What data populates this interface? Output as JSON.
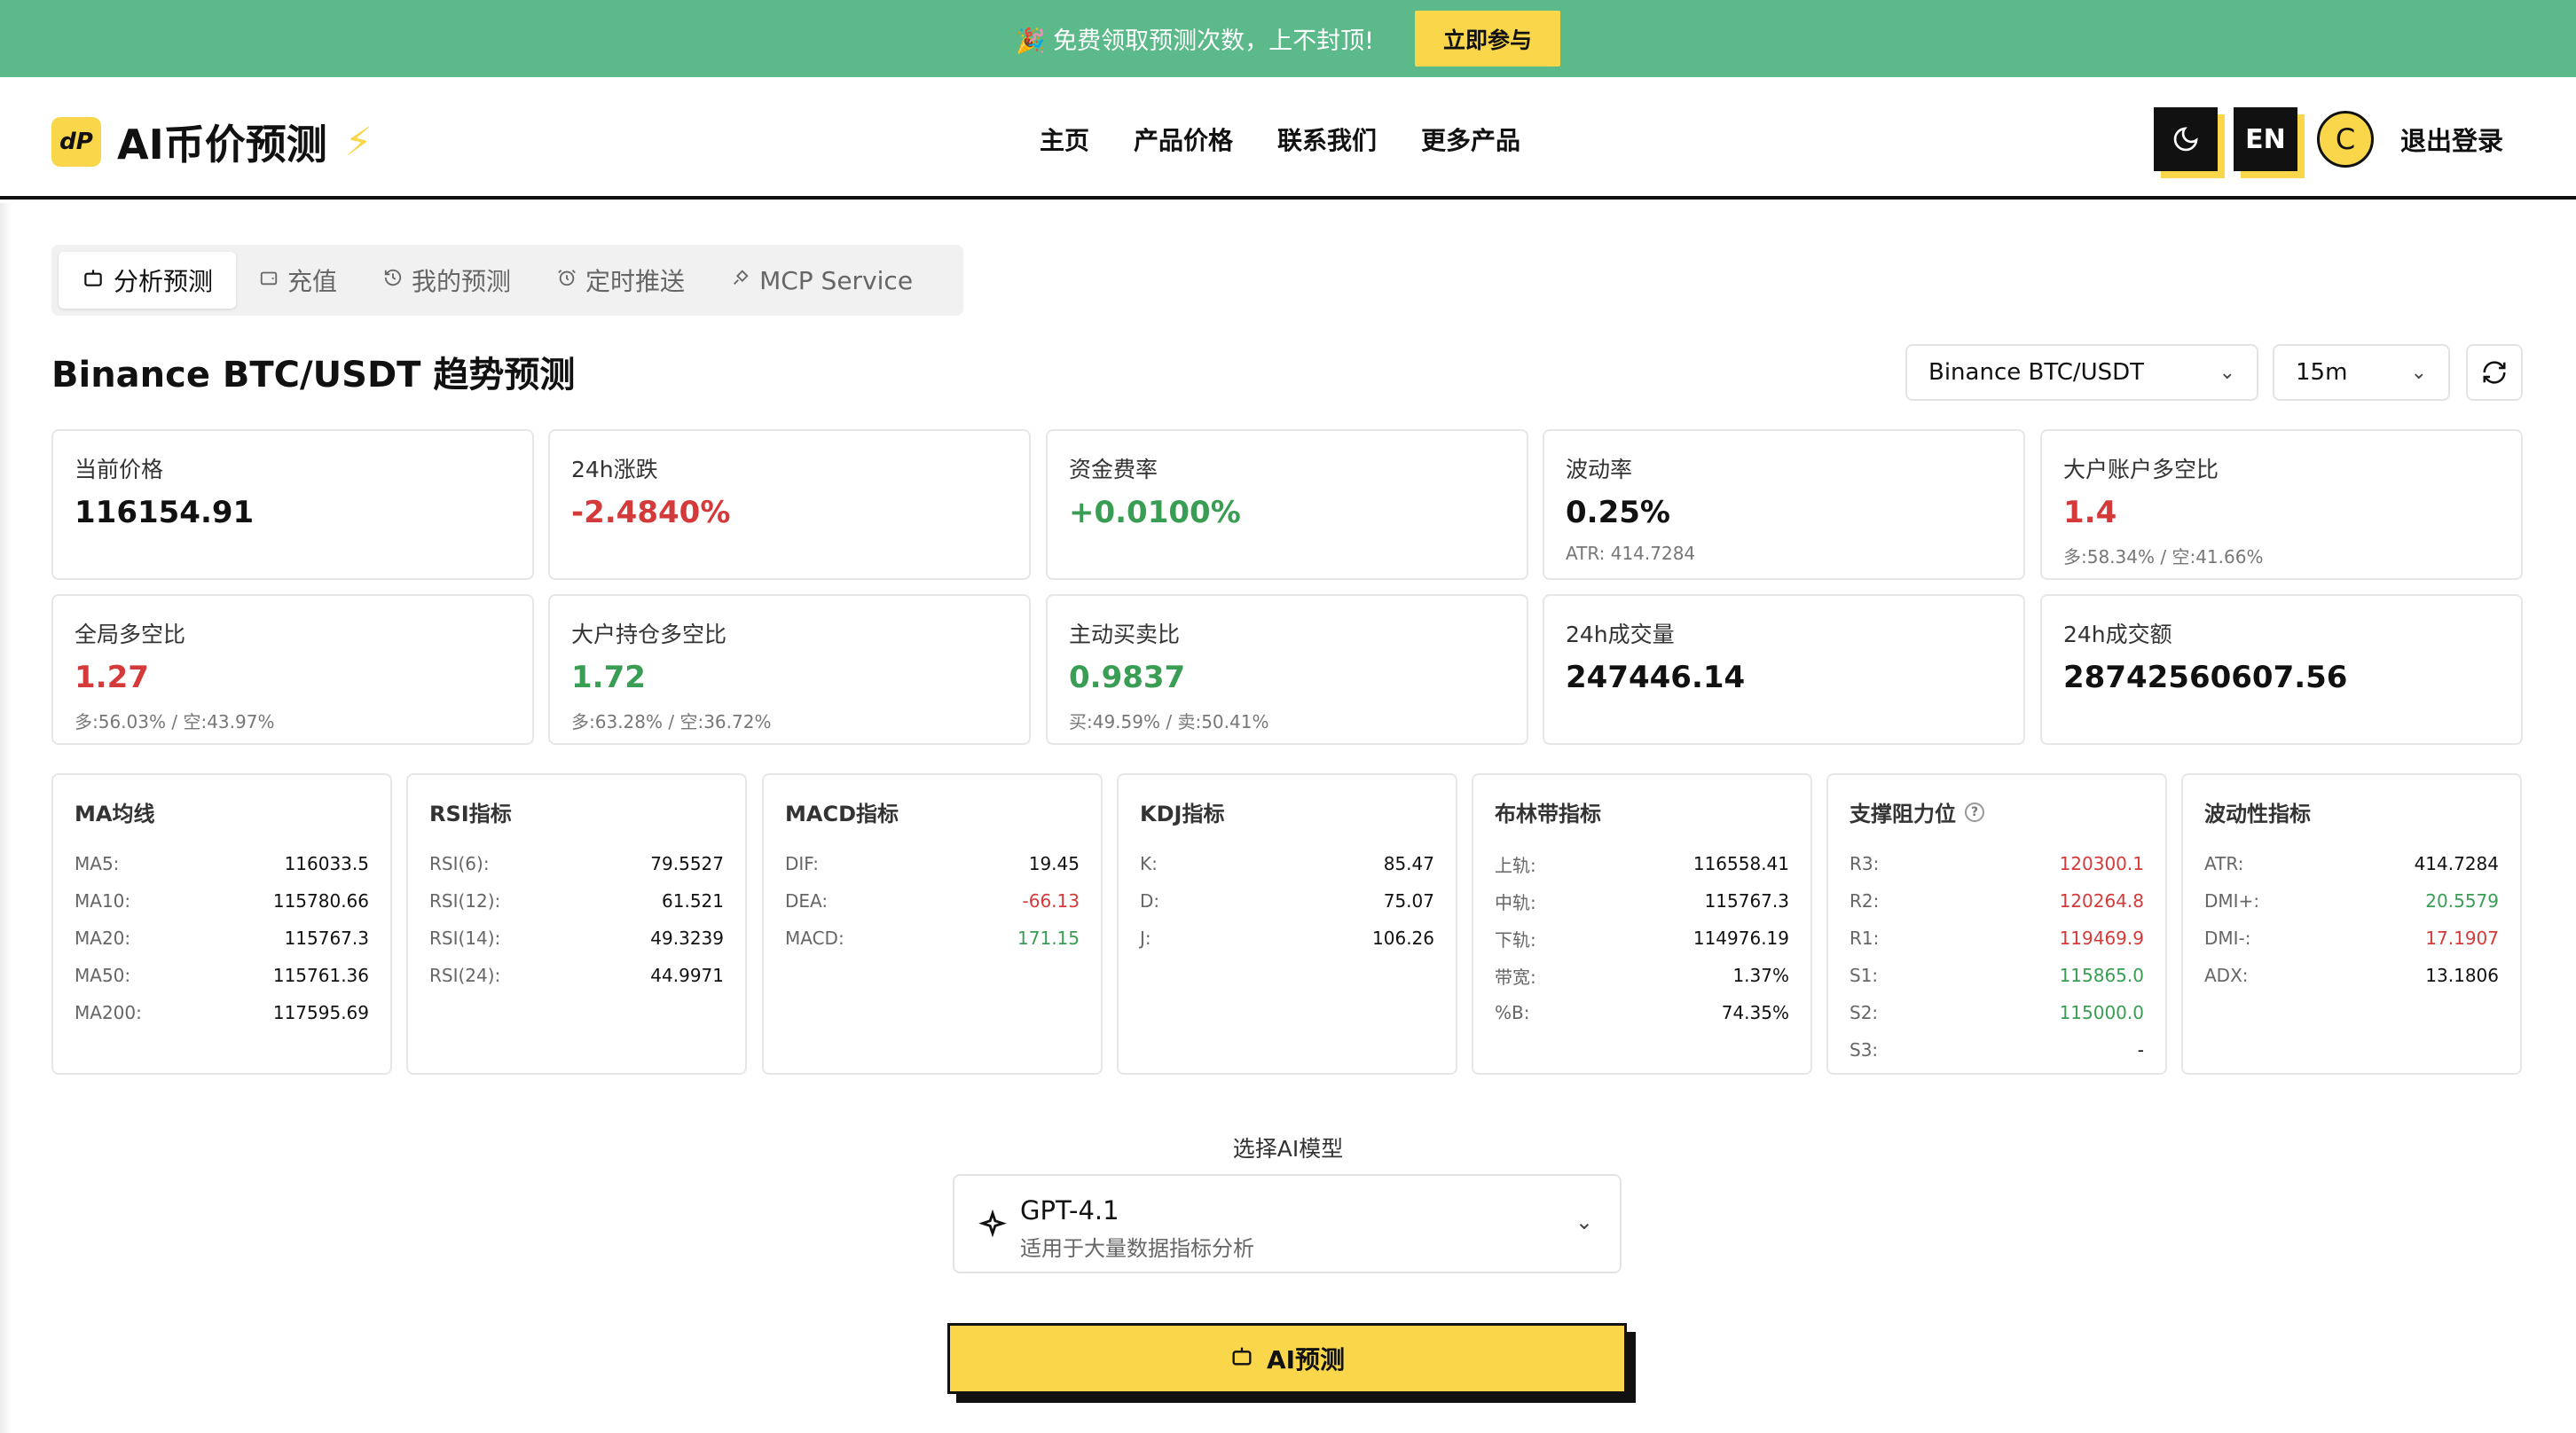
{
  "banner": {
    "text": "🎉 免费领取预测次数，上不封顶!",
    "button": "立即参与"
  },
  "header": {
    "logo_mark": "dP",
    "title": "AI币价预测",
    "nav": [
      "主页",
      "产品价格",
      "联系我们",
      "更多产品"
    ],
    "lang": "EN",
    "avatar": "C",
    "logout": "退出登录"
  },
  "tabs": [
    {
      "label": "分析预测",
      "icon": "robot-icon",
      "active": true
    },
    {
      "label": "充值",
      "icon": "wallet-icon",
      "active": false
    },
    {
      "label": "我的预测",
      "icon": "history-icon",
      "active": false
    },
    {
      "label": "定时推送",
      "icon": "alarm-icon",
      "active": false
    },
    {
      "label": "MCP Service",
      "icon": "plug-icon",
      "active": false
    }
  ],
  "page_title": "Binance BTC/USDT 趋势预测",
  "selectors": {
    "pair": "Binance BTC/USDT",
    "interval": "15m"
  },
  "stats": [
    {
      "label": "当前价格",
      "value": "116154.91",
      "sub": "",
      "tone": "neutral"
    },
    {
      "label": "24h涨跌",
      "value": "-2.4840%",
      "sub": "",
      "tone": "red"
    },
    {
      "label": "资金费率",
      "value": "+0.0100%",
      "sub": "",
      "tone": "green"
    },
    {
      "label": "波动率",
      "value": "0.25%",
      "sub": "ATR: 414.7284",
      "tone": "neutral"
    },
    {
      "label": "大户账户多空比",
      "value": "1.4",
      "sub": "多:58.34% / 空:41.66%",
      "tone": "red"
    },
    {
      "label": "全局多空比",
      "value": "1.27",
      "sub": "多:56.03% / 空:43.97%",
      "tone": "red"
    },
    {
      "label": "大户持仓多空比",
      "value": "1.72",
      "sub": "多:63.28% / 空:36.72%",
      "tone": "green"
    },
    {
      "label": "主动买卖比",
      "value": "0.9837",
      "sub": "买:49.59% / 卖:50.41%",
      "tone": "green"
    },
    {
      "label": "24h成交量",
      "value": "247446.14",
      "sub": "",
      "tone": "neutral"
    },
    {
      "label": "24h成交额",
      "value": "28742560607.56",
      "sub": "",
      "tone": "neutral"
    }
  ],
  "indicators": [
    {
      "title": "MA均线",
      "help": false,
      "rows": [
        {
          "k": "MA5:",
          "v": "116033.5",
          "tone": "neutral"
        },
        {
          "k": "MA10:",
          "v": "115780.66",
          "tone": "neutral"
        },
        {
          "k": "MA20:",
          "v": "115767.3",
          "tone": "neutral"
        },
        {
          "k": "MA50:",
          "v": "115761.36",
          "tone": "neutral"
        },
        {
          "k": "MA200:",
          "v": "117595.69",
          "tone": "neutral"
        }
      ]
    },
    {
      "title": "RSI指标",
      "help": false,
      "rows": [
        {
          "k": "RSI(6):",
          "v": "79.5527",
          "tone": "neutral"
        },
        {
          "k": "RSI(12):",
          "v": "61.521",
          "tone": "neutral"
        },
        {
          "k": "RSI(14):",
          "v": "49.3239",
          "tone": "neutral"
        },
        {
          "k": "RSI(24):",
          "v": "44.9971",
          "tone": "neutral"
        }
      ]
    },
    {
      "title": "MACD指标",
      "help": false,
      "rows": [
        {
          "k": "DIF:",
          "v": "19.45",
          "tone": "neutral"
        },
        {
          "k": "DEA:",
          "v": "-66.13",
          "tone": "red"
        },
        {
          "k": "MACD:",
          "v": "171.15",
          "tone": "green"
        }
      ]
    },
    {
      "title": "KDJ指标",
      "help": false,
      "rows": [
        {
          "k": "K:",
          "v": "85.47",
          "tone": "neutral"
        },
        {
          "k": "D:",
          "v": "75.07",
          "tone": "neutral"
        },
        {
          "k": "J:",
          "v": "106.26",
          "tone": "neutral"
        }
      ]
    },
    {
      "title": "布林带指标",
      "help": false,
      "rows": [
        {
          "k": "上轨:",
          "v": "116558.41",
          "tone": "neutral"
        },
        {
          "k": "中轨:",
          "v": "115767.3",
          "tone": "neutral"
        },
        {
          "k": "下轨:",
          "v": "114976.19",
          "tone": "neutral"
        },
        {
          "k": "带宽:",
          "v": "1.37%",
          "tone": "neutral"
        },
        {
          "k": "%B:",
          "v": "74.35%",
          "tone": "neutral"
        }
      ]
    },
    {
      "title": "支撑阻力位",
      "help": true,
      "rows": [
        {
          "k": "R3:",
          "v": "120300.1",
          "tone": "red"
        },
        {
          "k": "R2:",
          "v": "120264.8",
          "tone": "red"
        },
        {
          "k": "R1:",
          "v": "119469.9",
          "tone": "red"
        },
        {
          "k": "S1:",
          "v": "115865.0",
          "tone": "green"
        },
        {
          "k": "S2:",
          "v": "115000.0",
          "tone": "green"
        },
        {
          "k": "S3:",
          "v": "-",
          "tone": "neutral"
        }
      ]
    },
    {
      "title": "波动性指标",
      "help": false,
      "rows": [
        {
          "k": "ATR:",
          "v": "414.7284",
          "tone": "neutral"
        },
        {
          "k": "DMI+:",
          "v": "20.5579",
          "tone": "green"
        },
        {
          "k": "DMI-:",
          "v": "17.1907",
          "tone": "red"
        },
        {
          "k": "ADX:",
          "v": "13.1806",
          "tone": "neutral"
        }
      ]
    }
  ],
  "model": {
    "label": "选择AI模型",
    "name": "GPT-4.1",
    "desc": "适用于大量数据指标分析"
  },
  "predict_button": "AI预测",
  "colors": {
    "banner": "#5bb98a",
    "accent": "#f9d64a",
    "up": "#3a9d54",
    "down": "#d43a3a"
  }
}
